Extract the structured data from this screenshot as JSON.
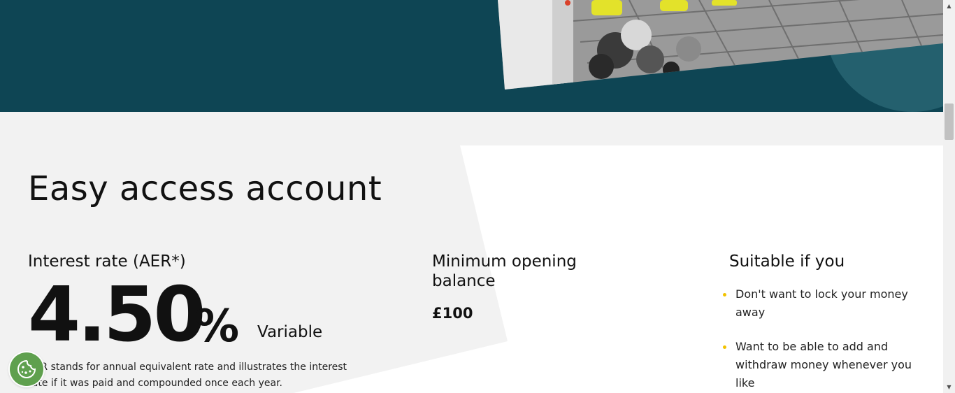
{
  "section": {
    "title": "Easy access account"
  },
  "interest": {
    "label": "Interest rate (AER*)",
    "rate": "4.50",
    "percent_sign": "%",
    "type": "Variable",
    "footnote": "AER stands for annual equivalent rate and illustrates the interest rate if it was paid and compounded once each year."
  },
  "minimum": {
    "label": "Minimum opening balance",
    "amount": "£100"
  },
  "suitable": {
    "label": "Suitable if you",
    "items": [
      "Don't want to lock your money away",
      "Want to be able to add and withdraw money whenever you like"
    ]
  },
  "colors": {
    "hero_bg": "#0e4554",
    "bullet": "#f2c200",
    "cookie_button": "#5fa04e"
  },
  "icons": {
    "cookie": "cookie-icon",
    "scroll_up": "chevron-up-icon",
    "scroll_down": "chevron-down-icon"
  }
}
